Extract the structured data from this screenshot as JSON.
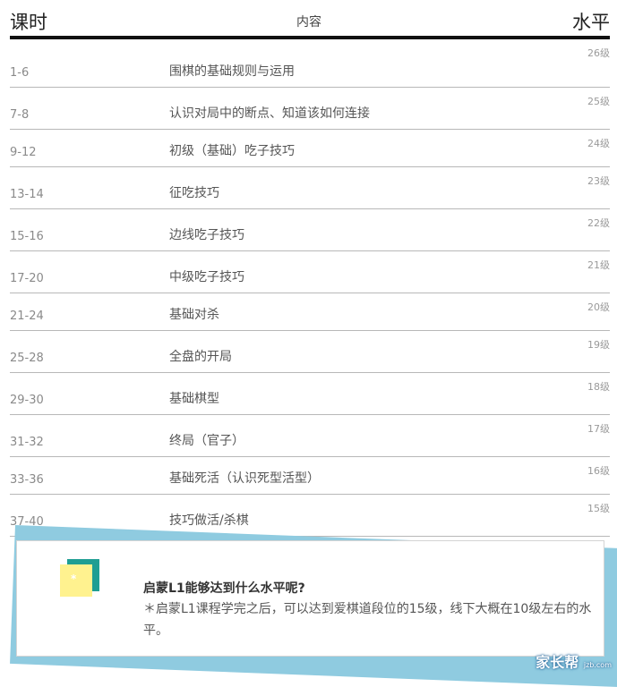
{
  "table": {
    "headers": {
      "lesson": "课时",
      "content": "内容",
      "level": "水平"
    },
    "rows": [
      {
        "lesson": "1-6",
        "content": "围棋的基础规则与运用",
        "level": "26级"
      },
      {
        "lesson": "7-8",
        "content": "认识对局中的断点、知道该如何连接",
        "level": "25级"
      },
      {
        "lesson": "9-12",
        "content": "初级（基础）吃子技巧",
        "level": "24级"
      },
      {
        "lesson": "13-14",
        "content": "征吃技巧",
        "level": "23级"
      },
      {
        "lesson": "15-16",
        "content": "边线吃子技巧",
        "level": "22级"
      },
      {
        "lesson": "17-20",
        "content": "中级吃子技巧",
        "level": "21级"
      },
      {
        "lesson": "21-24",
        "content": "基础对杀",
        "level": "20级"
      },
      {
        "lesson": "25-28",
        "content": "全盘的开局",
        "level": "19级"
      },
      {
        "lesson": "29-30",
        "content": "基础棋型",
        "level": "18级"
      },
      {
        "lesson": "31-32",
        "content": "终局（官子）",
        "level": "17级"
      },
      {
        "lesson": "33-36",
        "content": "基础死活（认识死型活型）",
        "level": "16级"
      },
      {
        "lesson": "37-40",
        "content": "技巧做活/杀棋",
        "level": "15级"
      }
    ]
  },
  "callout": {
    "icon": "sticky-note-icon",
    "title": "启蒙L1能够达到什么水平呢?",
    "body": "＊启蒙L1课程学完之后，可以达到爱棋道段位的15级，线下大概在10级左右的水平。"
  },
  "watermark": {
    "brand": "家长帮",
    "domain": "jzb.com"
  },
  "colors": {
    "accent": "#8fcbe0",
    "note_teal": "#1f9e93",
    "note_yellow": "#fff28f"
  }
}
